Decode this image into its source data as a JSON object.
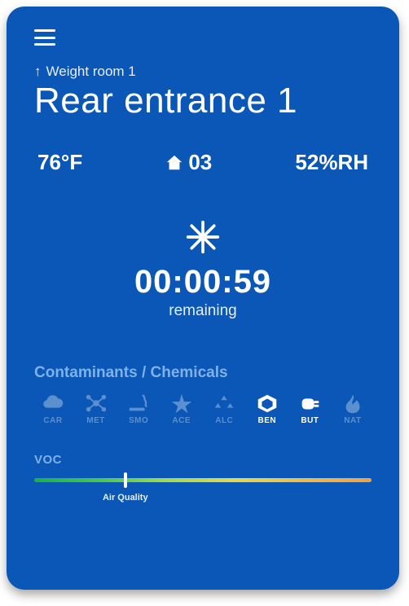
{
  "breadcrumb": {
    "label": "Weight room 1"
  },
  "title": "Rear entrance 1",
  "stats": {
    "temp": "76°F",
    "house_code": "03",
    "humidity": "52%RH"
  },
  "timer": {
    "value": "00:00:59",
    "sub": "remaining"
  },
  "contaminants": {
    "title": "Contaminants / Chemicals",
    "items": [
      {
        "code": "CAR"
      },
      {
        "code": "MET"
      },
      {
        "code": "SMO"
      },
      {
        "code": "ACE"
      },
      {
        "code": "ALC"
      },
      {
        "code": "BEN"
      },
      {
        "code": "BUT"
      },
      {
        "code": "NAT"
      }
    ]
  },
  "voc": {
    "title": "VOC",
    "caption": "Air Quality",
    "position_pct": 27
  }
}
